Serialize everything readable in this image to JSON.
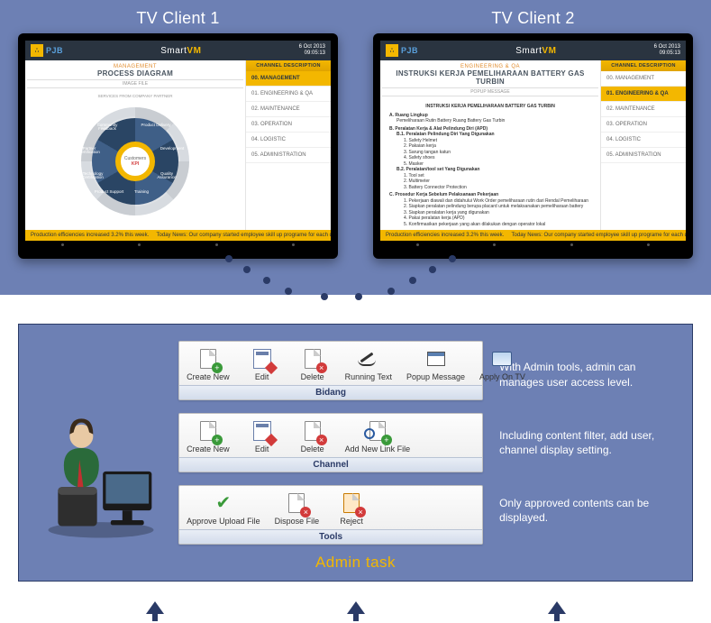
{
  "tv_clients": [
    {
      "caption": "TV Client 1"
    },
    {
      "caption": "TV Client 2"
    }
  ],
  "topbar": {
    "logo_letters": "PJB",
    "brand_pre": "Smart",
    "brand_em": "VM",
    "date": "6 Oct 2013",
    "time": "09:05:13"
  },
  "tv1": {
    "pretitle": "MANAGEMENT",
    "title": "PROCESS DIAGRAM",
    "subtitle": "IMAGE FILE",
    "core_top": "Customers",
    "core_bot": "KPI",
    "outer_caption": "SERVICES FROM COMPANY PARTNER",
    "segments": [
      "Product Delivery",
      "Development",
      "Quality Assurance",
      "Training",
      "Product Support",
      "Technology Certification",
      "Partner Certification",
      "Community Feedback"
    ]
  },
  "tv2": {
    "pretitle": "ENGINEERING & QA",
    "title": "INSTRUKSI KERJA PEMELIHARAAN BATTERY GAS TURBIN",
    "subtitle": "POPUP MESSAGE",
    "heading": "INSTRUKSI KERJA PEMELIHARAAN BATTERY GAS TURBIN",
    "lines": [
      "A.  Ruang Lingkup",
      "     Pemeliharaan Rutin Battery Ruang Battery Gas Turbin",
      "B.  Peralatan Kerja & Alat Pelindung Diri (APD)",
      "B.1. Peralatan Pelindung Diri Yang Digunakan",
      "1. Safety Helmet",
      "2. Pakaian kerja",
      "3. Sarung tangan katun",
      "4. Safety shoes",
      "5. Masker",
      "B.2. Peralatan/tool set Yang Digunakan",
      "1. Tool set",
      "2. Multimeter",
      "3. Battery Connector Protection",
      "C.  Prosedur Kerja Sebelum Pelaksanaan Pekerjaan",
      "1. Pekerjaan diawali dan didahului Work Order pemeliharaan rutin dari Rendal Pemeliharaan",
      "2. Siapkan peralatan pelindung berupa placard untuk melaksanakan pemeliharaan battery",
      "3. Siapkan peralatan kerja yang digunakan",
      "4. Pakai peralatan kerja (APD)",
      "5. Konfirmasikan pekerjaan yang akan dilakukan dengan operator lokal"
    ]
  },
  "channels": {
    "header": "CHANNEL DESCRIPTION",
    "items": [
      "00.  MANAGEMENT",
      "01.  ENGINEERING & QA",
      "02.  MAINTENANCE",
      "03.  OPERATION",
      "04.  LOGISTIC",
      "05.  ADMINISTRATION"
    ],
    "active_tv1": 0,
    "active_tv2": 1
  },
  "ticker": {
    "left": "Production efficiencies increased 3.2% this week.",
    "right": "Today News: Our company started employee skill up programe for each depart"
  },
  "toolbars": [
    {
      "title": "Bidang",
      "buttons": [
        {
          "label": "Create New",
          "icon": "doc-add"
        },
        {
          "label": "Edit",
          "icon": "note-edit"
        },
        {
          "label": "Delete",
          "icon": "doc-del"
        },
        {
          "label": "Running Text",
          "icon": "pen"
        },
        {
          "label": "Popup Message",
          "icon": "popup"
        },
        {
          "label": "Apply On TV",
          "icon": "tv"
        }
      ]
    },
    {
      "title": "Channel",
      "buttons": [
        {
          "label": "Create New",
          "icon": "doc-add"
        },
        {
          "label": "Edit",
          "icon": "note-edit"
        },
        {
          "label": "Delete",
          "icon": "doc-del"
        },
        {
          "label": "Add New Link File",
          "icon": "doc-link"
        }
      ]
    },
    {
      "title": "Tools",
      "buttons": [
        {
          "label": "Approve Upload File",
          "icon": "check"
        },
        {
          "label": "Dispose File",
          "icon": "doc-del"
        },
        {
          "label": "Reject",
          "icon": "doc-reject"
        }
      ]
    }
  ],
  "admin_texts": [
    "With Admin tools, admin can manages user access level.",
    "Including content filter, add user, channel display setting.",
    "Only approved contents can be displayed."
  ],
  "admin_label": "Admin task"
}
